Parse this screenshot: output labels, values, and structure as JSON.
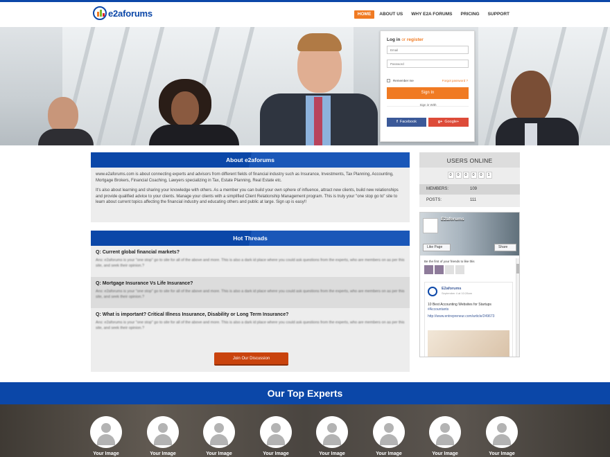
{
  "header": {
    "logo_text": "e2aforums",
    "nav": [
      {
        "label": "HOME",
        "active": true
      },
      {
        "label": "ABOUT US",
        "active": false
      },
      {
        "label": "WHY E2A FORUMS",
        "active": false
      },
      {
        "label": "PRICING",
        "active": false
      },
      {
        "label": "SUPPORT",
        "active": false
      }
    ]
  },
  "login": {
    "title_login": "Log in",
    "title_or": "or",
    "title_register": "register",
    "email_placeholder": "Email",
    "password_placeholder": "Password",
    "remember_label": "Remember me",
    "forgot_label": "Forgot password ?",
    "signin_label": "Sign In",
    "signwith_label": "Sign in With",
    "facebook_label": "Facebook",
    "google_label": "Google+"
  },
  "about": {
    "title": "About e2aforums",
    "paragraphs": [
      "www.e2aforums.com is about connecting experts and advisors from different fields of financial industry such as Insurance, Investments, Tax Planning, Accounting, Mortgage Brokers, Financial Coaching, Lawyers specializing in Tax, Estate Planning, Real Estate etc.",
      "It's also about learning and sharing your knowledge with others. As a member you can build your own sphere of influence, attract new clients, build new relationships and provide qualified advice to your clients. Manage your clients with a simplified Client Relationship Management program. This is truly your \"one stop go to\" site to learn about current topics affecting the financial industry and educating others and public at large. Sign up is easy!!"
    ]
  },
  "hot_threads": {
    "title": "Hot Threads",
    "threads": [
      {
        "question": "Q: Current global financial markets?",
        "answer": "Ans: e2aforums is your \"one stop\" go to site for all of the above and more. This is also a dark id place where you could ask questions from the experts, who are members on as per this site, and seek their opinion.?"
      },
      {
        "question": "Q: Mortgage Insurance Vs Life Insurance?",
        "answer": "Ans: e2aforums is your \"one stop\" go to site for all of the above and more. This is also a dark id place where you could ask questions from the experts, who are members on as per this site, and seek their opinion.?"
      },
      {
        "question": "Q: What is important? Critical Illness Insurance, Disability or Long Term Insurance?",
        "answer": "Ans: e2aforums is your \"one stop\" go to site for all of the above and more. This is also a dark id place where you could ask questions from the experts, who are members on as per this site, and seek their opinion.?"
      }
    ],
    "join_label": "Join Our Discussion"
  },
  "users_online": {
    "title": "USERS ONLINE",
    "digits": [
      "0",
      "0",
      "0",
      "0",
      "0",
      "1"
    ],
    "members_label": "MEMBERS:",
    "members_value": "109",
    "posts_label": "POSTS:",
    "posts_value": "111"
  },
  "facebook_widget": {
    "page_name": "E2aforums",
    "like_label": "Like Page",
    "share_label": "Share",
    "friends_text": "Be the first of your friends to like this",
    "post_author": "E2aforums",
    "post_date": "September 4 at 10:28am",
    "post_text": "10 Best Accounting Websites for Startups",
    "post_hashtag": "#Accountants",
    "post_link": "http://www.entrepreneur.com/article/249673"
  },
  "experts": {
    "title": "Our Top Experts",
    "items": [
      "Your Image",
      "Your Image",
      "Your Image",
      "Your Image",
      "Your Image",
      "Your Image",
      "Your Image",
      "Your Image"
    ]
  },
  "colors": {
    "brand_blue": "#0b47a8",
    "accent_orange": "#f07a22",
    "join_button": "#c9430d",
    "facebook": "#3b5998",
    "google": "#dd4b39"
  }
}
